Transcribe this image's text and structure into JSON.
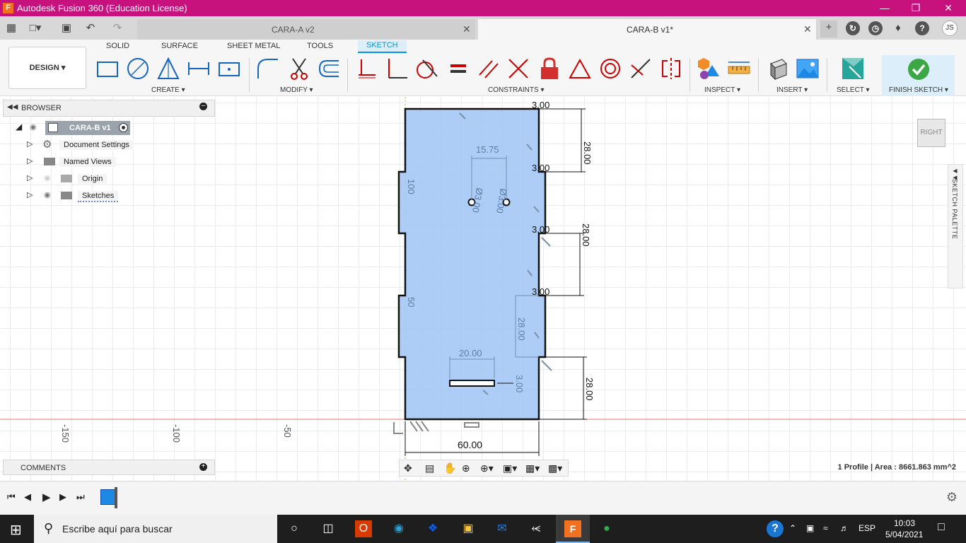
{
  "window": {
    "title": "Autodesk Fusion 360 (Education License)",
    "app_icon": "F"
  },
  "tabs": [
    {
      "label": "CARA-A v2",
      "active": false
    },
    {
      "label": "CARA-B v1*",
      "active": true
    }
  ],
  "user": {
    "initials": "JS"
  },
  "workspace": {
    "label": "DESIGN"
  },
  "ribbon_tabs": [
    "SOLID",
    "SURFACE",
    "SHEET METAL",
    "TOOLS",
    "SKETCH"
  ],
  "active_ribbon_tab": "SKETCH",
  "groups": {
    "create": "CREATE",
    "modify": "MODIFY",
    "constraints": "CONSTRAINTS",
    "inspect": "INSPECT",
    "insert": "INSERT",
    "select": "SELECT",
    "finish": "FINISH SKETCH"
  },
  "browser": {
    "title": "BROWSER",
    "root": "CARA-B v1",
    "items": [
      "Document Settings",
      "Named Views",
      "Origin",
      "Sketches"
    ]
  },
  "comments": {
    "title": "COMMENTS"
  },
  "viewcube": {
    "label": "RIGHT"
  },
  "sketch_palette": {
    "label": "SKETCH PALETTE"
  },
  "status": {
    "text": "1 Profile | Area : 8661.863 mm^2"
  },
  "sketch": {
    "dims": {
      "top_width": "3.00",
      "hole_spacing": "15.75",
      "hole_dia_left": "Ø3.00",
      "hole_dia_right": "Ø3.00",
      "tab_gap_1": "28.00",
      "tab_gap_2": "28.00",
      "tab_gap_3": "28.00",
      "tab_gap_4": "28.00",
      "notch_1": "3.00",
      "notch_2": "3.00",
      "notch_3": "3.00",
      "notch_4": "3.00",
      "slot_width": "20.00",
      "slot_height": "3.00",
      "overall_width": "60.00",
      "side_100": "100",
      "side_50": "50"
    },
    "axis_labels": [
      "-150",
      "-100",
      "-50"
    ]
  },
  "taskbar": {
    "search_placeholder": "Escribe aquí para buscar",
    "lang": "ESP",
    "time": "10:03",
    "date": "5/04/2021"
  },
  "colors": {
    "titlebar": "#c7117d",
    "accent": "#0696d7",
    "sketch_fill": "#a4c8f5"
  }
}
